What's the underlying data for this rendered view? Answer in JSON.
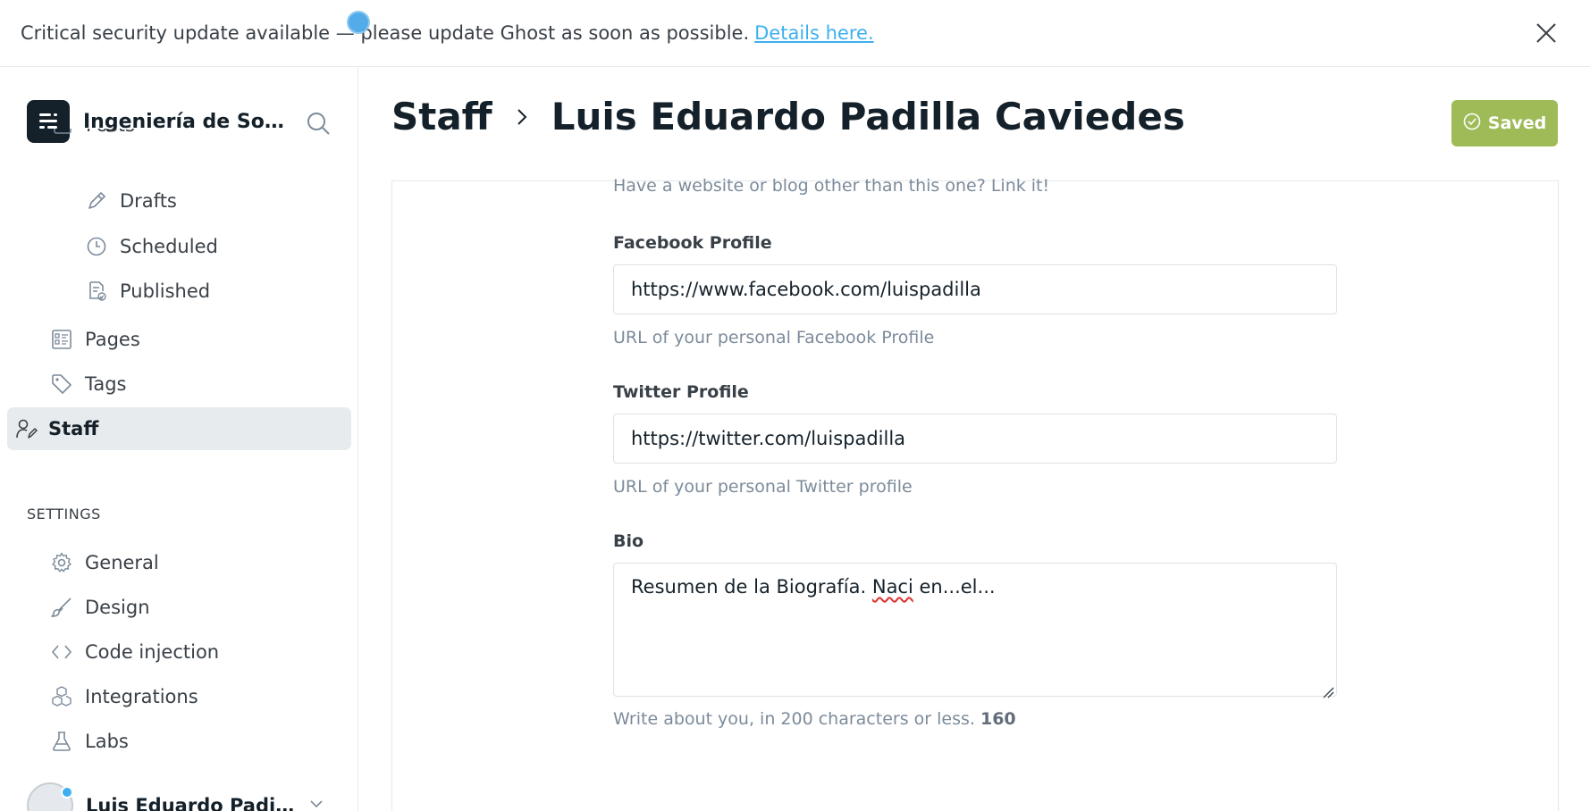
{
  "banner": {
    "text": "Critical security update available — please update Ghost as soon as possible.",
    "link": "Details here."
  },
  "sidebar": {
    "site_title": "Ingeniería de Soft...",
    "posts_partial": "Posts",
    "items": [
      {
        "label": "Drafts"
      },
      {
        "label": "Scheduled"
      },
      {
        "label": "Published"
      },
      {
        "label": "Pages"
      },
      {
        "label": "Tags"
      },
      {
        "label": "Staff"
      }
    ],
    "settings_heading": "SETTINGS",
    "settings_items": [
      {
        "label": "General"
      },
      {
        "label": "Design"
      },
      {
        "label": "Code injection"
      },
      {
        "label": "Integrations"
      },
      {
        "label": "Labs"
      }
    ],
    "user_name": "Luis Eduardo Padilla C..."
  },
  "header": {
    "section": "Staff",
    "name": "Luis Eduardo Padilla Caviedes",
    "saved_label": "Saved"
  },
  "form": {
    "website_hint": "Have a website or blog other than this one? Link it!",
    "facebook": {
      "label": "Facebook Profile",
      "value": "https://www.facebook.com/luispadilla",
      "hint": "URL of your personal Facebook Profile"
    },
    "twitter": {
      "label": "Twitter Profile",
      "value": "https://twitter.com/luispadilla",
      "hint": "URL of your personal Twitter profile"
    },
    "bio": {
      "label": "Bio",
      "value_before": "Resumen de la Biografía. ",
      "value_misspelled": "Naci",
      "value_after": " en...el...",
      "hint": "Write about you, in 200 characters or less.",
      "count": "160"
    }
  },
  "colors": {
    "saved_button": "#9fbb58",
    "link": "#3eb0ef",
    "active_nav_bg": "#e8ebee"
  }
}
